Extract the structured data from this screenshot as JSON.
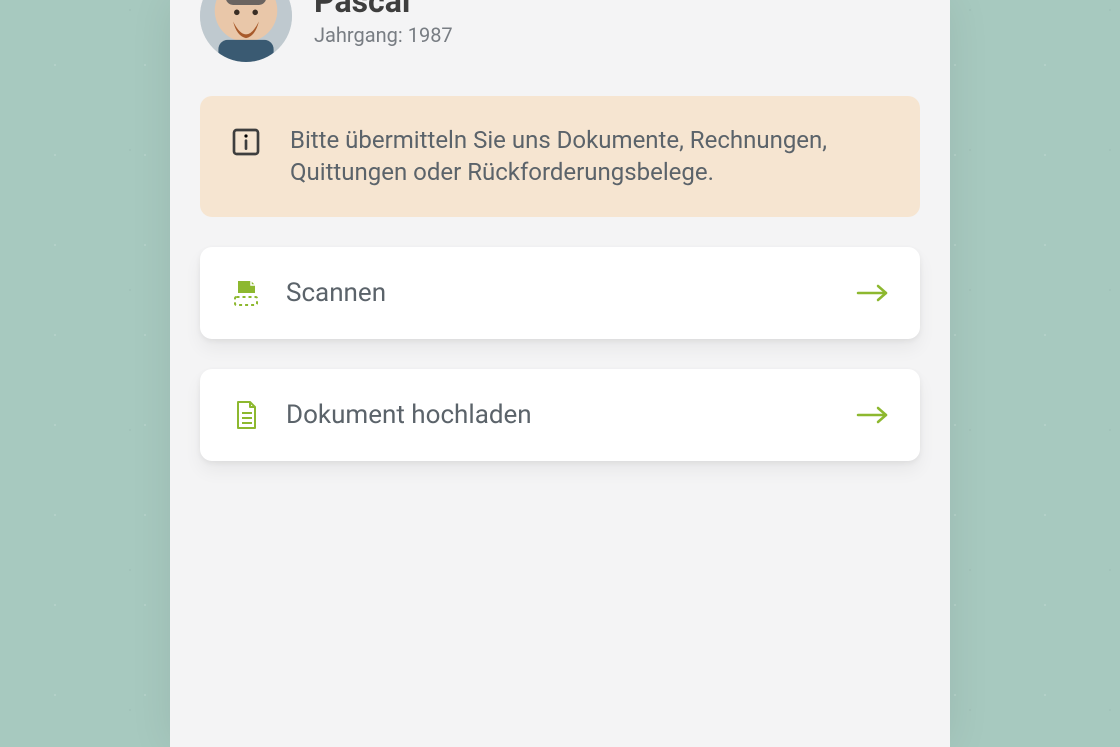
{
  "profile": {
    "name": "Pascal",
    "subline": "Jahrgang: 1987"
  },
  "info": {
    "text": "Bitte übermitteln Sie uns Dokumente, Rechnungen, Quittungen oder Rückforderungsbelege."
  },
  "actions": {
    "scan": {
      "label": "Scannen"
    },
    "upload": {
      "label": "Dokument hochladen"
    }
  },
  "colors": {
    "accent": "#8db82f",
    "info_bg": "#f6e5d1",
    "panel_bg": "#f4f4f5",
    "page_bg": "#a7c9bf"
  }
}
